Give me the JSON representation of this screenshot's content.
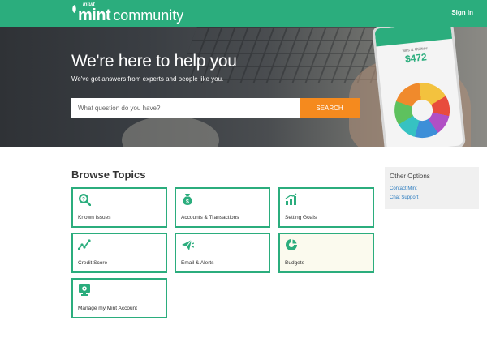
{
  "header": {
    "logo_intuit": "intuit",
    "logo_mint": "mint",
    "logo_community": "community",
    "signin_label": "Sign In",
    "brand_color": "#2bad7d"
  },
  "hero": {
    "title": "We're here to help you",
    "subtitle": "We've got answers from experts and people like you.",
    "search": {
      "placeholder": "What question do you have?",
      "value": "",
      "button_label": "SEARCH",
      "button_color": "#f58a1e"
    },
    "phone": {
      "category": "Bills & Utilities",
      "amount": "$472"
    }
  },
  "browse": {
    "title": "Browse Topics",
    "tiles": [
      {
        "label": "Known Issues",
        "icon": "magnifier-question-icon"
      },
      {
        "label": "Accounts & Transactions",
        "icon": "money-bag-icon"
      },
      {
        "label": "Setting Goals",
        "icon": "bar-chart-icon"
      },
      {
        "label": "Credit Score",
        "icon": "trend-line-icon"
      },
      {
        "label": "Email & Alerts",
        "icon": "email-alert-icon"
      },
      {
        "label": "Budgets",
        "icon": "pie-chart-icon"
      },
      {
        "label": "Manage my Mint Account",
        "icon": "monitor-gear-icon"
      }
    ]
  },
  "other_options": {
    "title": "Other Options",
    "links": [
      "Contact Mint",
      "Chat Support"
    ]
  }
}
